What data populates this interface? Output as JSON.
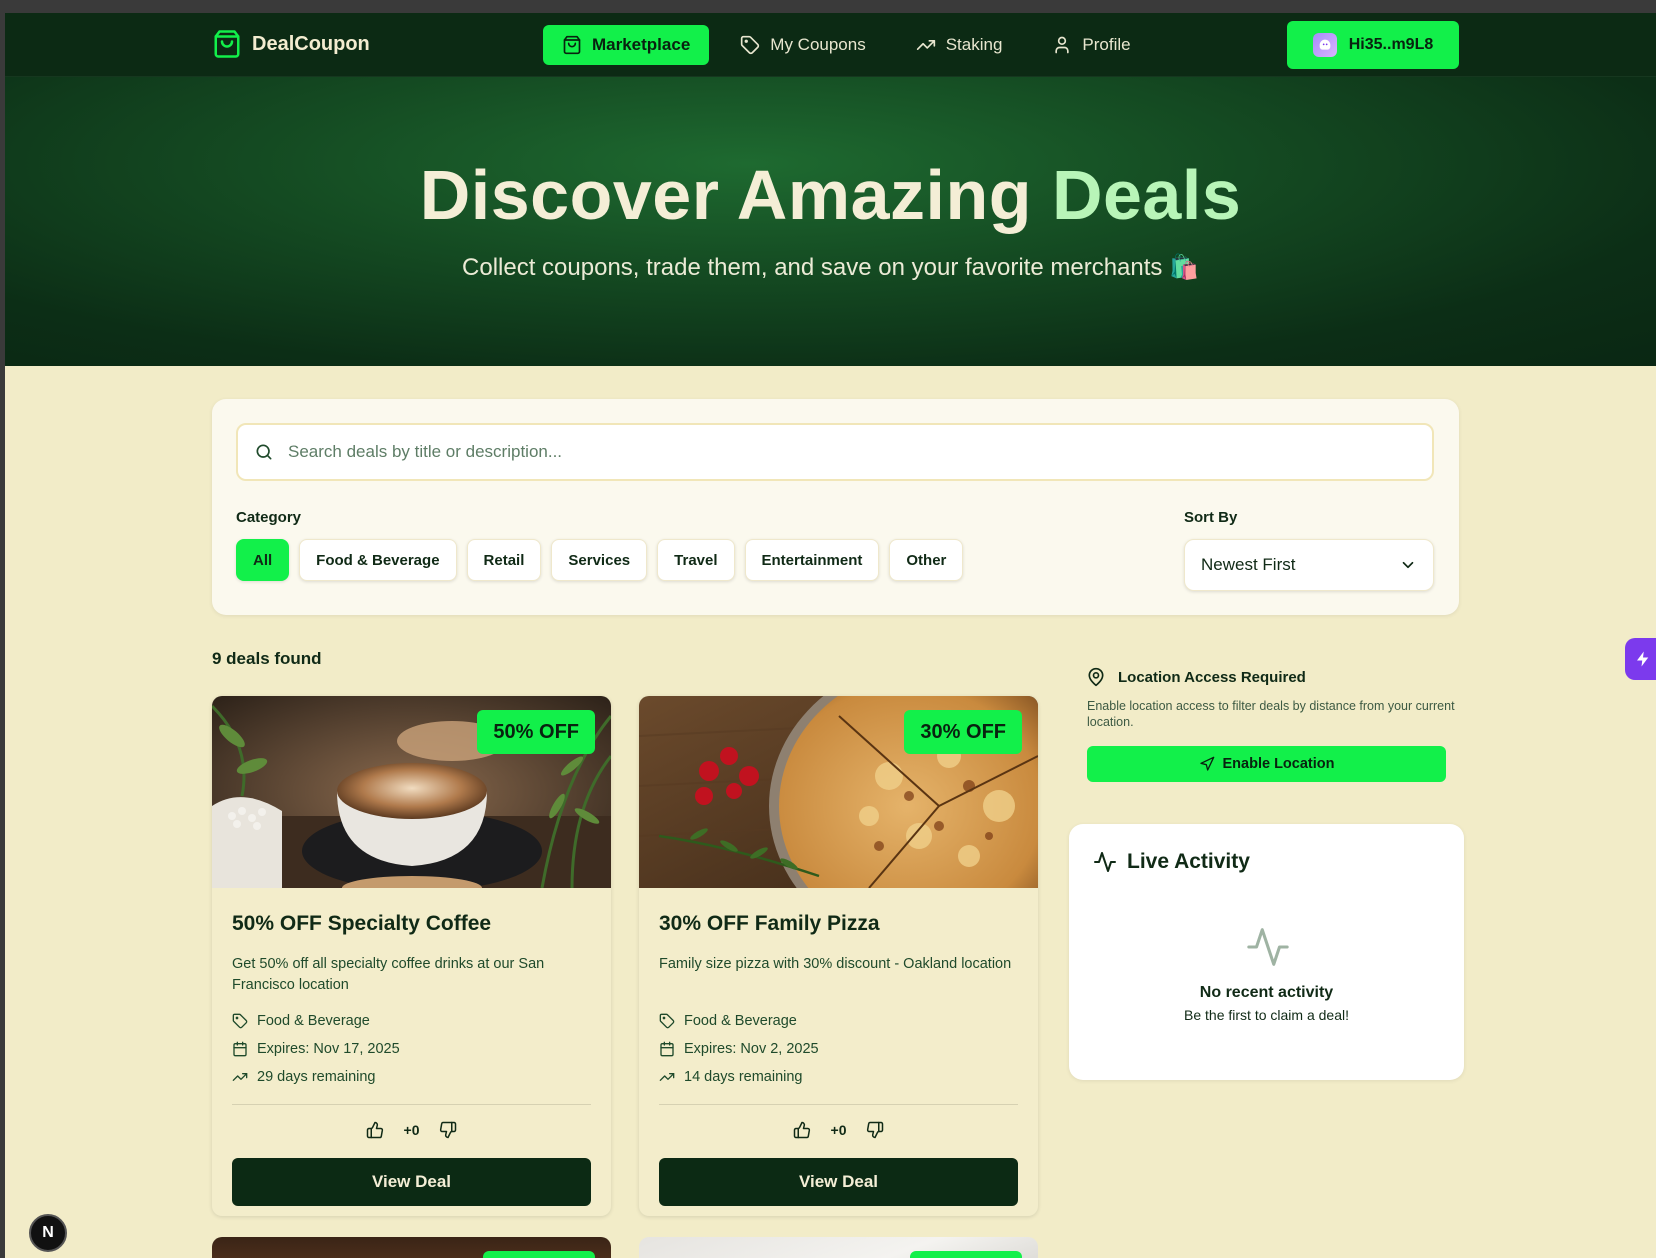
{
  "nav": {
    "brand": "DealCoupon",
    "links": [
      {
        "label": "Marketplace",
        "icon": "shopping-bag-icon",
        "active": true
      },
      {
        "label": "My Coupons",
        "icon": "tag-icon",
        "active": false
      },
      {
        "label": "Staking",
        "icon": "trending-up-icon",
        "active": false
      },
      {
        "label": "Profile",
        "icon": "user-icon",
        "active": false
      }
    ],
    "wallet": "Hi35..m9L8"
  },
  "hero": {
    "title_main": "Discover Amazing",
    "title_accent": "Deals",
    "subtitle": "Collect coupons, trade them, and save on your favorite merchants 🛍️"
  },
  "filters": {
    "search_placeholder": "Search deals by title or description...",
    "category_label": "Category",
    "categories": [
      "All",
      "Food & Beverage",
      "Retail",
      "Services",
      "Travel",
      "Entertainment",
      "Other"
    ],
    "active_category": "All",
    "sort_label": "Sort By",
    "sort_value": "Newest First"
  },
  "results": {
    "count_text": "9 deals found"
  },
  "deals": [
    {
      "badge": "50% OFF",
      "title": "50% OFF Specialty Coffee",
      "description": "Get 50% off all specialty coffee drinks at our San Francisco location",
      "category": "Food & Beverage",
      "expires": "Expires: Nov 17, 2025",
      "remaining": "29 days remaining",
      "votes": "+0",
      "button": "View Deal"
    },
    {
      "badge": "30% OFF",
      "title": "30% OFF Family Pizza",
      "description": "Family size pizza with 30% discount - Oakland location",
      "category": "Food & Beverage",
      "expires": "Expires: Nov 2, 2025",
      "remaining": "14 days remaining",
      "votes": "+0",
      "button": "View Deal"
    }
  ],
  "location": {
    "title": "Location Access Required",
    "description": "Enable location access to filter deals by distance from your current location.",
    "button": "Enable Location"
  },
  "live_activity": {
    "title": "Live Activity",
    "empty_title": "No recent activity",
    "empty_subtitle": "Be the first to claim a deal!"
  },
  "colors": {
    "accent": "#12f04a",
    "dark": "#0c2a14",
    "background": "#f2ecc8"
  }
}
